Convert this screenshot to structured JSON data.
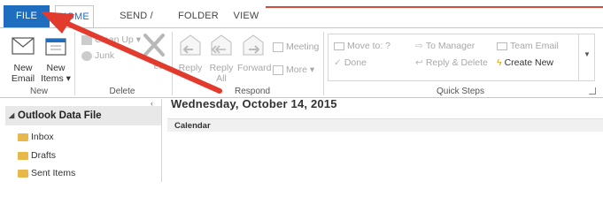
{
  "tabs": {
    "file": "FILE",
    "home": "HOME",
    "send_receive": "SEND / RECEIVE",
    "folder": "FOLDER",
    "view": "VIEW"
  },
  "groups": {
    "new": {
      "label": "New",
      "new_email_line1": "New",
      "new_email_line2": "Email",
      "new_items_line1": "New",
      "new_items_line2": "Items ▾"
    },
    "delete": {
      "label": "Delete",
      "clean_up": "Clean Up ▾",
      "junk": "Junk",
      "delete_partial": "ete"
    },
    "respond": {
      "label": "Respond",
      "reply": "Reply",
      "reply_all_line1": "Reply",
      "reply_all_line2": "All",
      "forward": "Forward",
      "meeting": "Meeting",
      "more": "More ▾"
    },
    "quick_steps": {
      "label": "Quick Steps",
      "move_to": "Move to: ?",
      "to_manager": "To Manager",
      "team_email": "Team Email",
      "done": "Done",
      "reply_delete": "Reply & Delete",
      "create_new": "Create New"
    }
  },
  "nav": {
    "header": "Outlook Data File",
    "items": [
      "Inbox",
      "Drafts",
      "Sent Items"
    ]
  },
  "main": {
    "date": "Wednesday, October 14, 2015",
    "section": "Calendar"
  },
  "colors": {
    "file_tab": "#1e6dbe",
    "arrow": "#e23b2e"
  }
}
